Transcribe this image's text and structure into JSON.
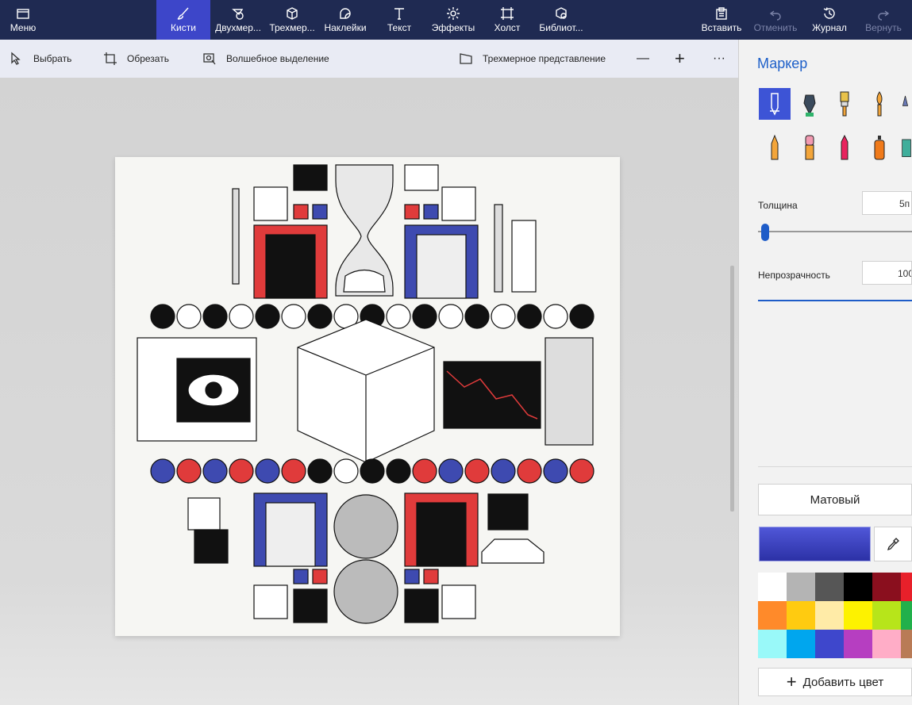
{
  "topbar": {
    "menu": "Меню",
    "tabs": [
      {
        "id": "brushes",
        "label": "Кисти"
      },
      {
        "id": "shapes2d",
        "label": "Двухмер..."
      },
      {
        "id": "shapes3d",
        "label": "Трехмер..."
      },
      {
        "id": "stickers",
        "label": "Наклейки"
      },
      {
        "id": "text",
        "label": "Текст"
      },
      {
        "id": "effects",
        "label": "Эффекты"
      },
      {
        "id": "canvas",
        "label": "Холст"
      },
      {
        "id": "library",
        "label": "Библиот..."
      }
    ],
    "active_tab": "Кисти",
    "paste": "Вставить",
    "undo": "Отменить",
    "history": "Журнал",
    "redo": "Вернуть"
  },
  "toolbar": {
    "select": "Выбрать",
    "crop": "Обрезать",
    "magic_select": "Волшебное выделение",
    "view_3d": "Трехмерное представление",
    "zoom_out": "—",
    "zoom_in": "+",
    "more": "···"
  },
  "panel": {
    "title": "Маркер",
    "thickness_label": "Толщина",
    "thickness_value": "5п",
    "thickness_fraction": 0.05,
    "opacity_label": "Непрозрачность",
    "opacity_value": "100",
    "matte": "Матовый",
    "selected_color": "#3e45c4",
    "add_color": "Добавить цвет",
    "brushes": [
      "marker",
      "calligraphy-pen",
      "oil-brush",
      "watercolor",
      "pencil",
      "eraser",
      "crayon",
      "spray-can",
      "pixel-pen"
    ],
    "palette": [
      "#ffffff",
      "#b4b4b4",
      "#565656",
      "#000000",
      "#8a0f1e",
      "#e8202a",
      "#ff8a2a",
      "#ffcb10",
      "#ffeba7",
      "#fdf200",
      "#b7e51a",
      "#22b04b",
      "#99f9f9",
      "#00a6ee",
      "#3e47cc",
      "#b63ec1",
      "#ffadc7",
      "#b97b56"
    ]
  }
}
